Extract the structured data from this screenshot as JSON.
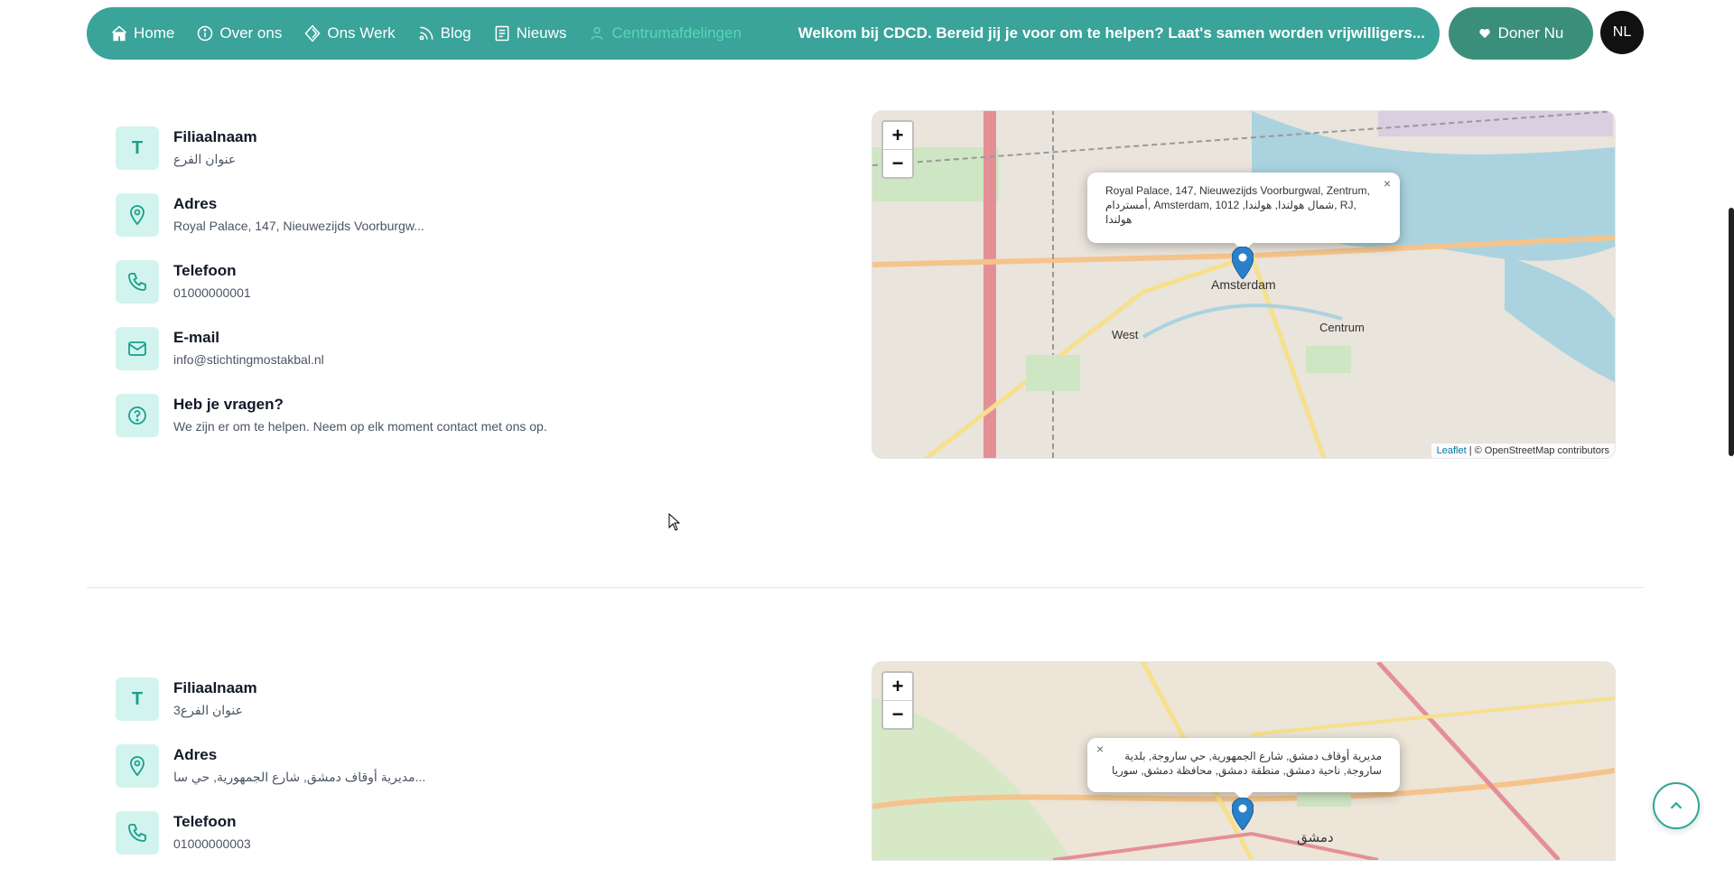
{
  "nav": {
    "items": [
      {
        "label": "Home",
        "icon": "home-icon"
      },
      {
        "label": "Over ons",
        "icon": "info-icon"
      },
      {
        "label": "Ons Werk",
        "icon": "diamond-icon"
      },
      {
        "label": "Blog",
        "icon": "rss-icon"
      },
      {
        "label": "Nieuws",
        "icon": "newspaper-icon"
      },
      {
        "label": "Centrumafdelingen",
        "icon": "users-icon",
        "active": true
      }
    ],
    "marquee": "Welkom bij CDCD. Bereid jij je voor om te helpen? Laat's samen worden vrijwilligers...",
    "donate_label": "Doner Nu",
    "language": "NL"
  },
  "branches": [
    {
      "name_label": "Filiaalnaam",
      "name_value": "عنوان الفرع",
      "address_label": "Adres",
      "address_value": "Royal Palace, 147, Nieuwezijds Voorburgw...",
      "phone_label": "Telefoon",
      "phone_value": "01000000001",
      "email_label": "E-mail",
      "email_value": "info@stichtingmostakbal.nl",
      "question_label": "Heb je vragen?",
      "question_value": "We zijn er om te helpen. Neem op elk moment contact met ons op.",
      "map": {
        "popup": "Royal Palace, 147, Nieuwezijds Voorburgwal, Zentrum, أمستردام, Amsterdam, 1012 ,شمال هولندا, هولندا, RJ, هولندا",
        "city_label": "Amsterdam",
        "label_centrum": "Centrum",
        "label_west": "West",
        "attribution_leaflet": "Leaflet",
        "attribution_osm": "| © OpenStreetMap contributors"
      }
    },
    {
      "name_label": "Filiaalnaam",
      "name_value": "عنوان الفرع3",
      "address_label": "Adres",
      "address_value": "مديرية أوقاف دمشق, شارع الجمهورية, حي سا...",
      "phone_label": "Telefoon",
      "phone_value": "01000000003",
      "map": {
        "popup": "مديرية أوقاف دمشق, شارع الجمهورية, حي ساروجة, بلدية ساروجة, ناحية دمشق, منطقة دمشق, محافظة دمشق, سوريا",
        "city_label": "دمشق"
      }
    }
  ],
  "map_controls": {
    "zoom_in": "+",
    "zoom_out": "−",
    "close": "×"
  },
  "colors": {
    "nav_bg": "#3aa39a",
    "accent": "#16a08c",
    "icon_bg": "#d3f4ee",
    "donate_bg": "#3a8f7a"
  }
}
